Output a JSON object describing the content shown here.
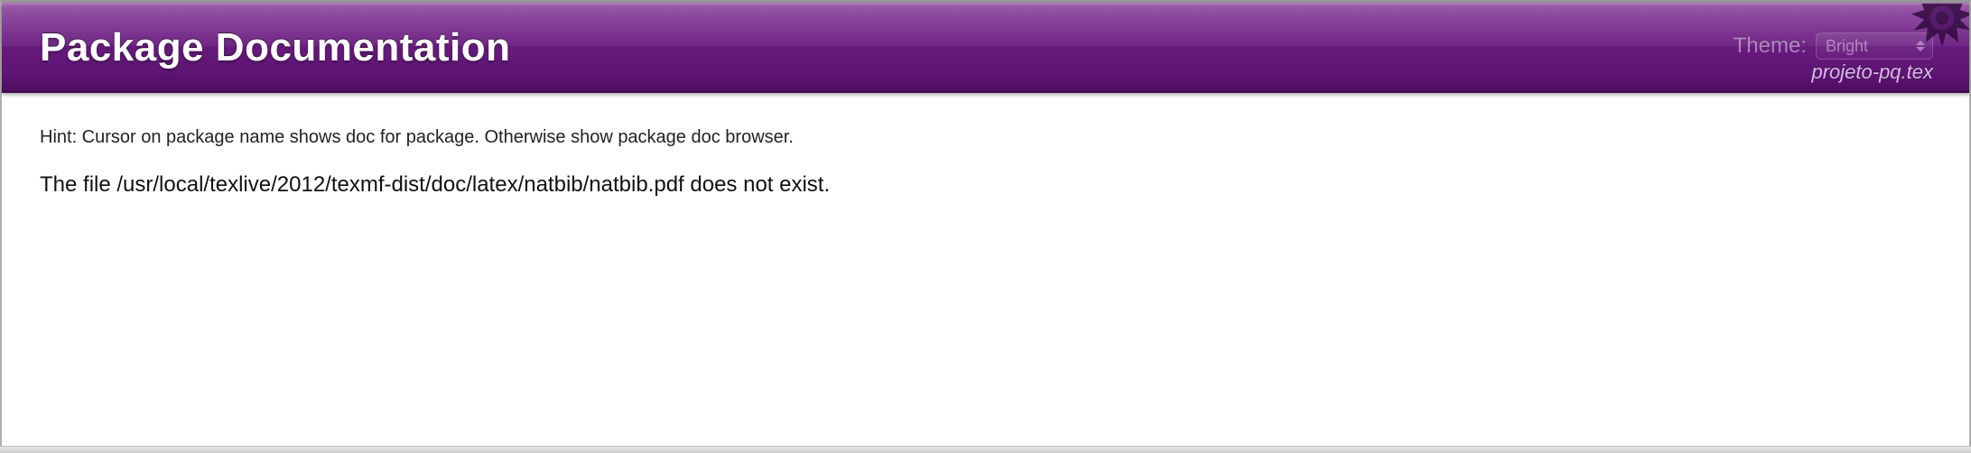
{
  "header": {
    "title": "Package Documentation",
    "theme_label": "Theme:",
    "theme_selected": "Bright",
    "filename": "projeto-pq.tex"
  },
  "content": {
    "hint": "Hint: Cursor on package name shows doc for package. Otherwise show package doc browser.",
    "message": "The file /usr/local/texlive/2012/texmf-dist/doc/latex/natbib/natbib.pdf does not exist."
  }
}
